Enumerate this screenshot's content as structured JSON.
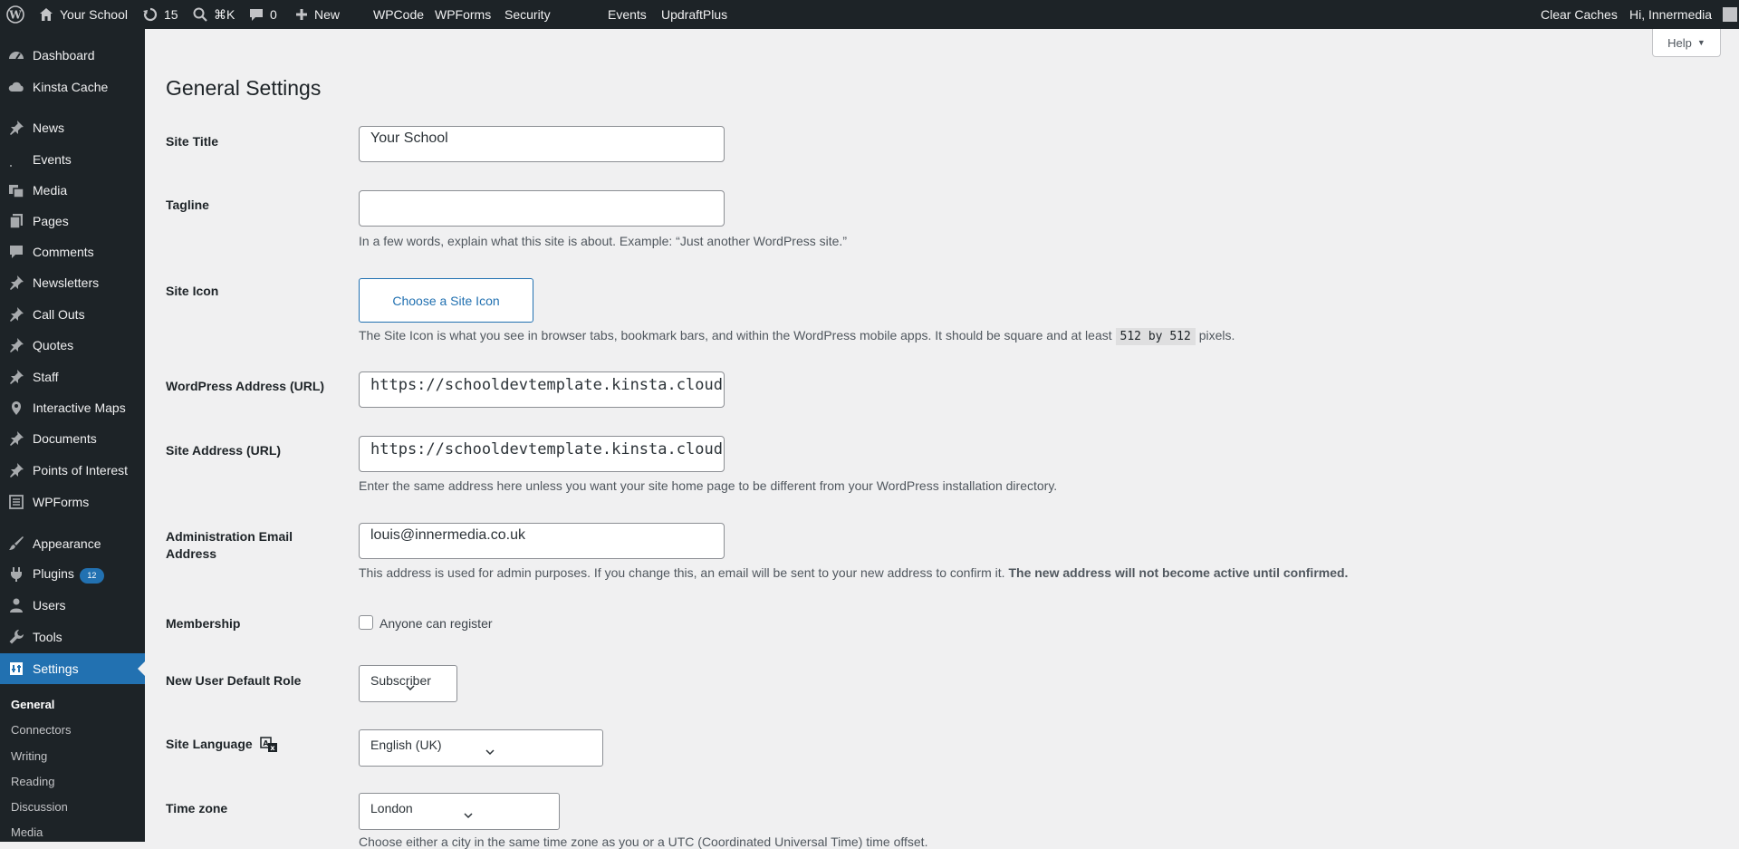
{
  "admin_bar": {
    "site_name": "Your School",
    "updates_count": "15",
    "search_shortcut": "⌘K",
    "comments_count": "0",
    "new_label": "New",
    "links": [
      "WPCode",
      "WPForms",
      "Security",
      "Events",
      "UpdraftPlus"
    ],
    "clear_caches": "Clear Caches",
    "greeting": "Hi, Innermedia"
  },
  "sidebar": {
    "items": [
      {
        "label": "Dashboard",
        "icon": "dashboard-icon"
      },
      {
        "label": "Kinsta Cache",
        "icon": "cloud-icon"
      },
      {
        "label": "News",
        "icon": "pin-icon"
      },
      {
        "label": "Events",
        "icon": "events-icon"
      },
      {
        "label": "Media",
        "icon": "media-icon"
      },
      {
        "label": "Pages",
        "icon": "pages-icon"
      },
      {
        "label": "Comments",
        "icon": "comments-icon"
      },
      {
        "label": "Newsletters",
        "icon": "pin-icon"
      },
      {
        "label": "Call Outs",
        "icon": "pin-icon"
      },
      {
        "label": "Quotes",
        "icon": "pin-icon"
      },
      {
        "label": "Staff",
        "icon": "pin-icon"
      },
      {
        "label": "Interactive Maps",
        "icon": "location-icon"
      },
      {
        "label": "Documents",
        "icon": "pin-icon"
      },
      {
        "label": "Points of Interest",
        "icon": "pin-icon"
      },
      {
        "label": "WPForms",
        "icon": "forms-icon"
      },
      {
        "label": "Appearance",
        "icon": "brush-icon"
      },
      {
        "label": "Plugins",
        "icon": "plugin-icon",
        "badge": "12"
      },
      {
        "label": "Users",
        "icon": "users-icon"
      },
      {
        "label": "Tools",
        "icon": "wrench-icon"
      },
      {
        "label": "Settings",
        "icon": "settings-icon",
        "current": true
      }
    ],
    "submenu": [
      "General",
      "Connectors",
      "Writing",
      "Reading",
      "Discussion",
      "Media"
    ]
  },
  "help_label": "Help",
  "page_title": "General Settings",
  "form": {
    "site_title": {
      "label": "Site Title",
      "value": "Your School"
    },
    "tagline": {
      "label": "Tagline",
      "value": "",
      "description": "In a few words, explain what this site is about. Example: “Just another WordPress site.”"
    },
    "site_icon": {
      "label": "Site Icon",
      "button": "Choose a Site Icon",
      "description_pre": "The Site Icon is what you see in browser tabs, bookmark bars, and within the WordPress mobile apps. It should be square and at least",
      "description_code": "512 by 512",
      "description_post": "pixels."
    },
    "wp_address": {
      "label": "WordPress Address (URL)",
      "value": "https://schooldevtemplate.kinsta.cloud"
    },
    "site_address": {
      "label": "Site Address (URL)",
      "value": "https://schooldevtemplate.kinsta.cloud",
      "description": "Enter the same address here unless you want your site home page to be different from your WordPress installation directory."
    },
    "admin_email": {
      "label_line1": "Administration Email",
      "label_line2": "Address",
      "value": "louis@innermedia.co.uk",
      "description": "This address is used for admin purposes. If you change this, an email will be sent to your new address to confirm it.",
      "description_bold": "The new address will not become active until confirmed."
    },
    "membership": {
      "label": "Membership",
      "checkbox_label": "Anyone can register",
      "checked": false
    },
    "default_role": {
      "label": "New User Default Role",
      "value": "Subscriber"
    },
    "site_language": {
      "label": "Site Language",
      "value": "English (UK)"
    },
    "timezone": {
      "label": "Time zone",
      "value": "London",
      "description": "Choose either a city in the same time zone as you or a UTC (Coordinated Universal Time) time offset."
    }
  },
  "colors": {
    "admin_bg": "#1d2327",
    "accent": "#2271b1",
    "content_bg": "#f0f0f1"
  }
}
